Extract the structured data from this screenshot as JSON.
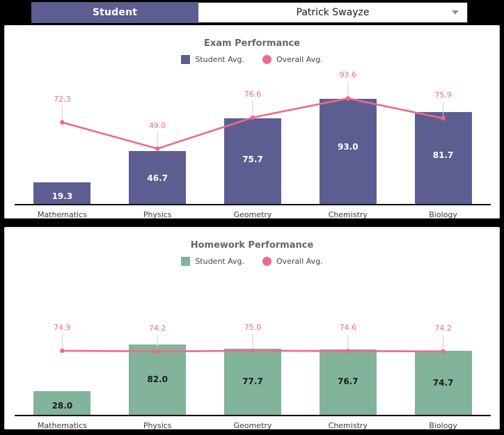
{
  "slicer": {
    "label": "Student",
    "selected_value": "Patrick Swayze",
    "dropdown_icon": "chevron-down-icon"
  },
  "colors": {
    "exam_bar": "#5C5E91",
    "homework_bar": "#82B39B",
    "line": "#ED6A88",
    "header_purple": "#5C5E91",
    "title_gray": "#666666",
    "page_background": "#000000",
    "card_background": "#FFFFFF"
  },
  "charts": [
    {
      "id": "exam",
      "title": "Exam Performance",
      "legend": [
        {
          "label": "Student Avg.",
          "marker": "square",
          "color": "#5C5E91"
        },
        {
          "label": "Overall Avg.",
          "marker": "circle",
          "color": "#ED6A88"
        }
      ],
      "categories": [
        "Mathematics",
        "Physics",
        "Geometry",
        "Chemistry",
        "Biology"
      ],
      "bar_values": [
        "19.3",
        "46.7",
        "75.7",
        "93.0",
        "81.7"
      ],
      "line_values": [
        "72.3",
        "49.0",
        "76.6",
        "93.6",
        "75.9"
      ],
      "value_label_color": "light"
    },
    {
      "id": "homework",
      "title": "Homework Performance",
      "legend": [
        {
          "label": "Student Avg.",
          "marker": "square",
          "color": "#82B39B"
        },
        {
          "label": "Overall Avg.",
          "marker": "circle",
          "color": "#ED6A88"
        }
      ],
      "categories": [
        "Mathematics",
        "Physics",
        "Geometry",
        "Chemistry",
        "Biology"
      ],
      "bar_values": [
        "28.0",
        "82.0",
        "77.7",
        "76.7",
        "74.7"
      ],
      "line_values": [
        "74.9",
        "74.2",
        "75.0",
        "74.6",
        "74.2"
      ],
      "value_label_color": "dark"
    }
  ],
  "chart_data": [
    {
      "type": "bar",
      "title": "Exam Performance",
      "xlabel": "",
      "ylabel": "",
      "ylim": [
        0,
        100
      ],
      "grid": false,
      "legend_position": "top-center",
      "categories": [
        "Mathematics",
        "Physics",
        "Geometry",
        "Chemistry",
        "Biology"
      ],
      "series": [
        {
          "name": "Student Avg.",
          "type": "bar",
          "color": "#5C5E91",
          "values": [
            19.3,
            46.7,
            75.7,
            93.0,
            81.7
          ]
        },
        {
          "name": "Overall Avg.",
          "type": "line",
          "color": "#ED6A88",
          "values": [
            72.3,
            49.0,
            76.6,
            93.6,
            75.9
          ]
        }
      ]
    },
    {
      "type": "bar",
      "title": "Homework Performance",
      "xlabel": "",
      "ylabel": "",
      "ylim": [
        0,
        100
      ],
      "grid": false,
      "legend_position": "top-center",
      "categories": [
        "Mathematics",
        "Physics",
        "Geometry",
        "Chemistry",
        "Biology"
      ],
      "series": [
        {
          "name": "Student Avg.",
          "type": "bar",
          "color": "#82B39B",
          "values": [
            28.0,
            82.0,
            77.7,
            76.7,
            74.7
          ]
        },
        {
          "name": "Overall Avg.",
          "type": "line",
          "color": "#ED6A88",
          "values": [
            74.9,
            74.2,
            75.0,
            74.6,
            74.2
          ]
        }
      ]
    }
  ]
}
